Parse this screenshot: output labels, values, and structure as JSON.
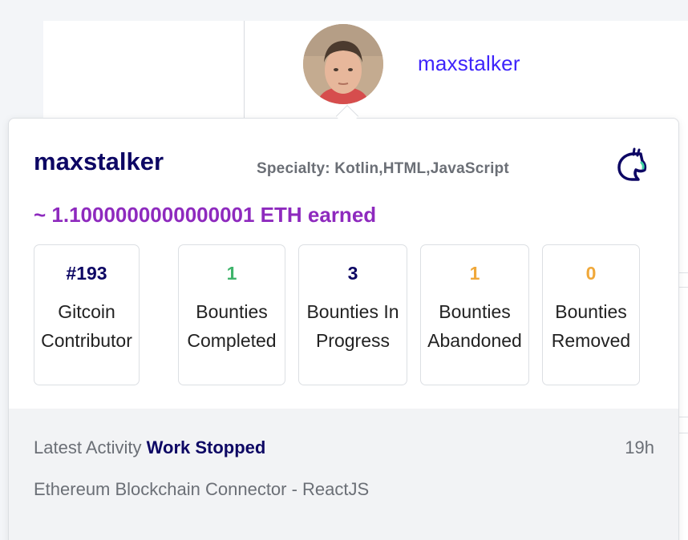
{
  "header": {
    "username": "maxstalker"
  },
  "card": {
    "name": "maxstalker",
    "specialty": "Specialty: Kotlin,HTML,JavaScript",
    "earned": "~ 1.1000000000000001 ETH earned",
    "logo_icon": "gitcoin-logo-icon",
    "stats": [
      {
        "value": "#193",
        "label_line1": "Gitcoin",
        "label_line2": "Contributor",
        "color": "#0d0764"
      },
      {
        "value": "1",
        "label_line1": "Bounties",
        "label_line2": "Completed",
        "color": "#3fb46b"
      },
      {
        "value": "3",
        "label_line1": "Bounties In",
        "label_line2": "Progress",
        "color": "#0d0764"
      },
      {
        "value": "1",
        "label_line1": "Bounties",
        "label_line2": "Abandoned",
        "color": "#f0a83a"
      },
      {
        "value": "0",
        "label_line1": "Bounties",
        "label_line2": "Removed",
        "color": "#f0a83a"
      }
    ]
  },
  "activity": {
    "prefix": "Latest Activity",
    "event": "Work Stopped",
    "time": "19h",
    "title": "Ethereum Blockchain Connector - ReactJS"
  },
  "colors": {
    "accent_link": "#3e24fb",
    "name": "#0d0764",
    "earned": "#8e2abe"
  }
}
